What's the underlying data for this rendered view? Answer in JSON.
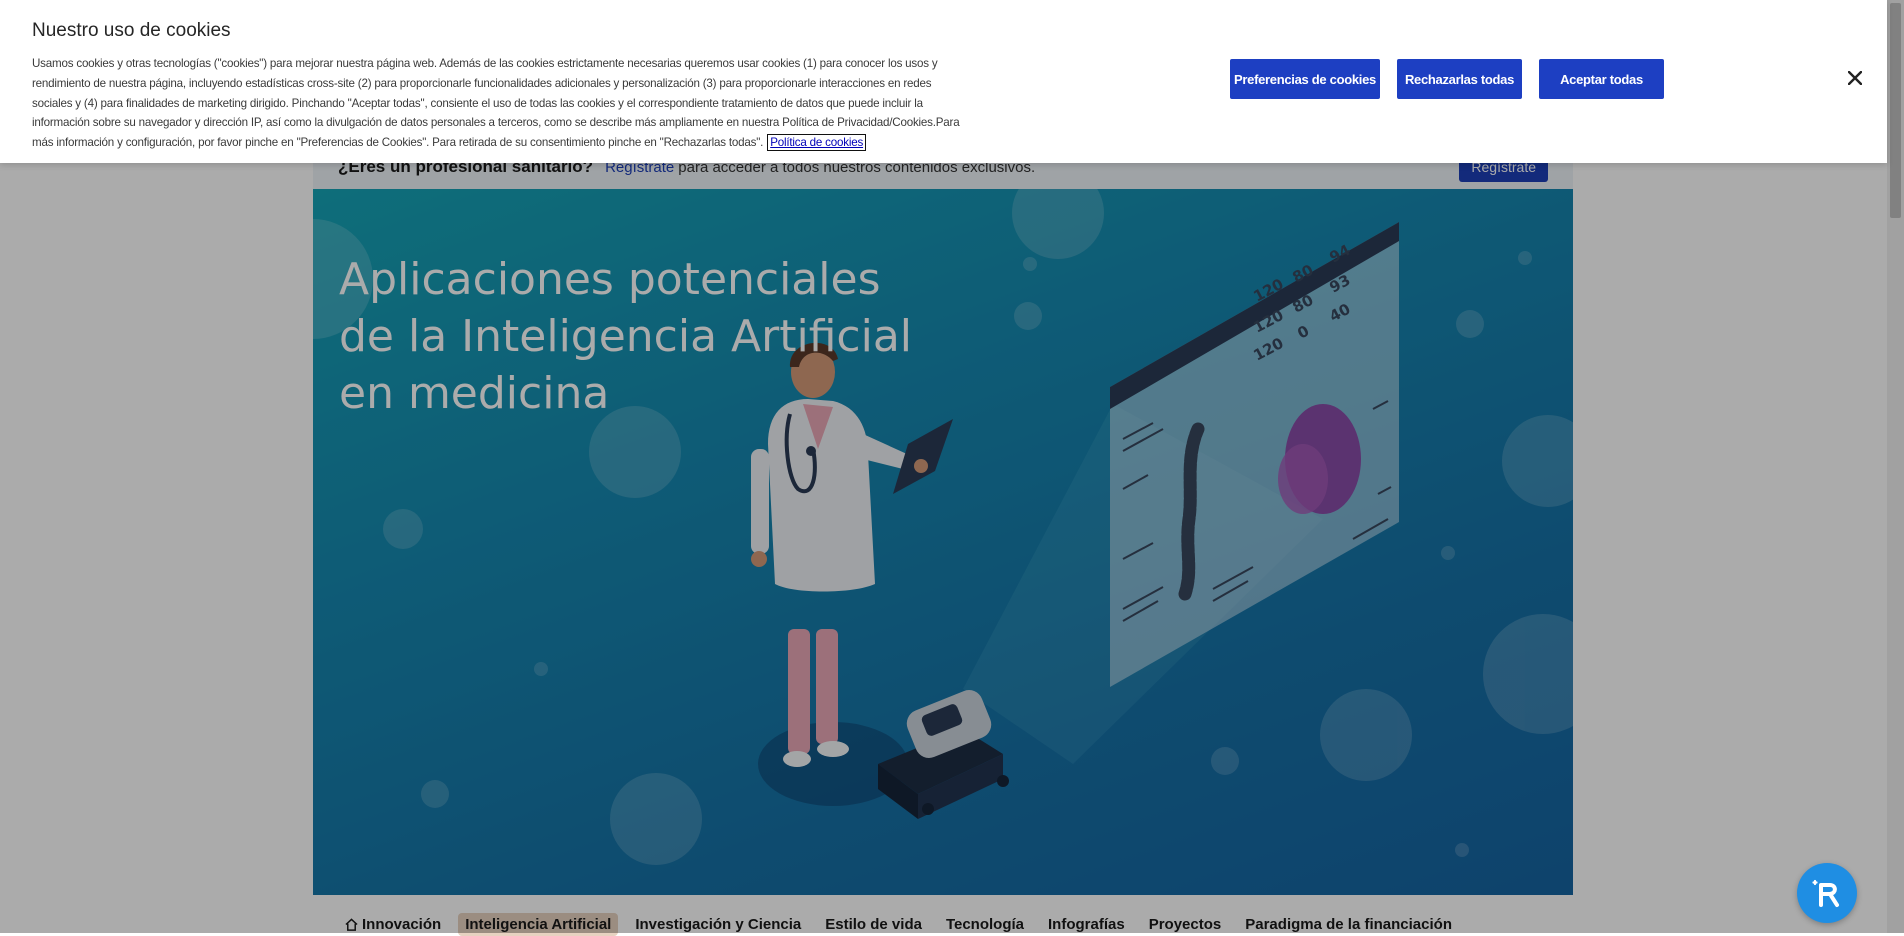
{
  "registration_banner": {
    "question": "¿Eres un profesional sanitario?",
    "link_text": "Regístrate",
    "tail_text": "para acceder a todos nuestros contenidos exclusivos.",
    "button_label": "Regístrate"
  },
  "hero": {
    "title": "Aplicaciones potenciales de la Inteligencia Artificial en medicina",
    "monitor_numbers": [
      "120",
      "80",
      "94",
      "120",
      "80",
      "93",
      "120",
      "0",
      "40"
    ]
  },
  "nav": {
    "items": [
      {
        "label": "Innovación",
        "icon": "home-icon"
      },
      {
        "label": "Inteligencia Artificial",
        "active": true
      },
      {
        "label": "Investigación y Ciencia"
      },
      {
        "label": "Estilo de vida"
      },
      {
        "label": "Tecnología"
      },
      {
        "label": "Infografías"
      },
      {
        "label": "Proyectos"
      },
      {
        "label": "Paradigma de la financiación"
      }
    ]
  },
  "cookie_banner": {
    "title": "Nuestro uso de cookies",
    "lines": [
      "Usamos cookies y otras tecnologías (\"cookies\") para mejorar nuestra página web. Además de las cookies estrictamente necesarias queremos usar cookies (1) para conocer los usos y",
      "rendimiento de nuestra página, incluyendo estadísticas cross-site (2) para proporcionarle funcionalidades adicionales y personalización (3) para proporcionarle interacciones en redes",
      "sociales y (4) para finalidades de marketing dirigido. Pinchando \"Aceptar todas\", consiente el uso de todas las cookies y el correspondiente tratamiento de datos que puede incluir la",
      "información sobre su navegador y dirección IP, así como la divulgación de datos personales a terceros, como se describe más ampliamente en nuestra Política de Privacidad/Cookies.Para",
      "más información y configuración, por favor pinche en \"Preferencias de Cookies\". Para retirada de su consentimiento pinche en \"Rechazarlas todas\"."
    ],
    "policy_link": "Política de cookies",
    "buttons": {
      "preferences": "Preferencias de cookies",
      "reject": "Rechazarlas todas",
      "accept": "Aceptar todas"
    },
    "close_icon": "close-icon"
  },
  "assistant": {
    "icon": "assistant-icon",
    "color": "#1f8ee3"
  },
  "colors": {
    "primary_button": "#1d3fc2",
    "hero_gradient_start": "#16a4b6",
    "hero_gradient_end": "#1664a2",
    "active_nav": "#e7d2c1"
  }
}
